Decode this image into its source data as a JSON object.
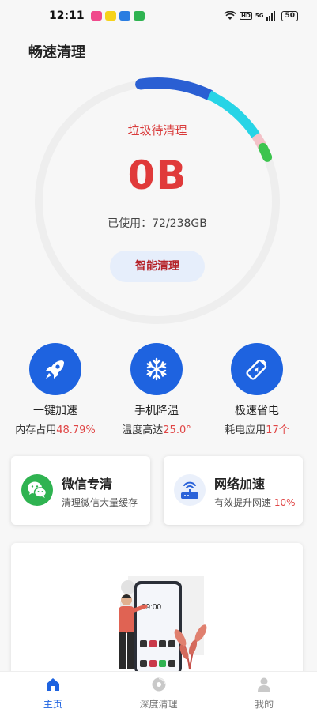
{
  "status_bar": {
    "time": "12:11",
    "network": "5G",
    "hd": "HD",
    "battery": "50"
  },
  "app_title": "畅速清理",
  "gauge": {
    "label": "垃圾待清理",
    "value": "0B",
    "used_prefix": "已使用：",
    "used_value": "72/238GB",
    "used_gb": 72,
    "total_gb": 238,
    "button": "智能清理",
    "colors": {
      "segment1": "#2a5fd3",
      "segment2": "#27d4e6",
      "segment3": "#f3c2c8",
      "segment4": "#3cc44e",
      "track": "#eeeeee"
    }
  },
  "features": [
    {
      "icon": "rocket-icon",
      "name": "一键加速",
      "sub_prefix": "内存占用",
      "sub_value": "48.79%"
    },
    {
      "icon": "snowflake-icon",
      "name": "手机降温",
      "sub_prefix": "温度高达",
      "sub_value": "25.0°"
    },
    {
      "icon": "battery-icon",
      "name": "极速省电",
      "sub_prefix": "耗电应用",
      "sub_value": "17个"
    }
  ],
  "cards": [
    {
      "icon": "wechat-icon",
      "title": "微信专清",
      "desc_prefix": "清理微信大量缓存",
      "desc_value": ""
    },
    {
      "icon": "router-icon",
      "title": "网络加速",
      "desc_prefix": "有效提升网速 ",
      "desc_value": "10%"
    }
  ],
  "banner": {
    "phone_time": "09:00"
  },
  "nav": [
    {
      "icon": "home-icon",
      "label": "主页",
      "active": true
    },
    {
      "icon": "disc-icon",
      "label": "深度清理",
      "active": false
    },
    {
      "icon": "user-icon",
      "label": "我的",
      "active": false
    }
  ],
  "accent": "#1e63e0",
  "highlight": "#e04545"
}
